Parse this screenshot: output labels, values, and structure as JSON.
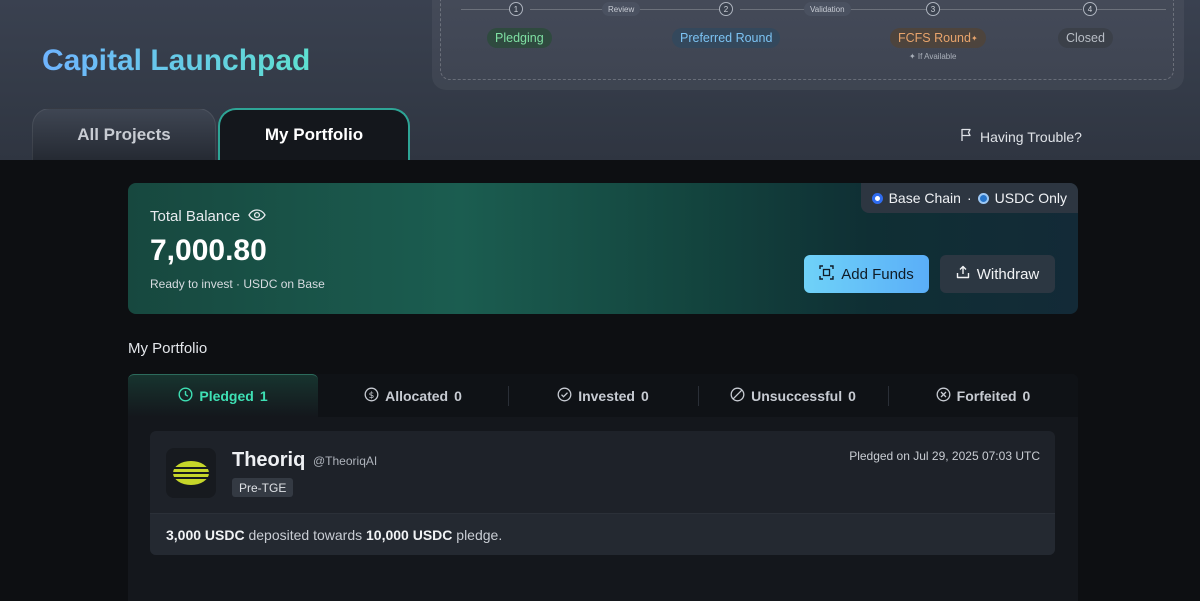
{
  "app": {
    "title": "Capital Launchpad"
  },
  "stepper": {
    "steps": [
      {
        "num": "1",
        "label": "Pledging",
        "color": "#7fe0a3",
        "bg": "#3b4c48"
      },
      {
        "num": "2",
        "label": "Preferred Round",
        "color": "#7cc3f3",
        "bg": "#3a4858"
      },
      {
        "num": "3",
        "label": "FCFS Round",
        "superscript": "✦",
        "sub": "✦ If Available",
        "color": "#e8a46c",
        "bg": "#4f4842"
      },
      {
        "num": "4",
        "label": "Closed",
        "color": "#b8bdc5",
        "bg": "#40454f"
      }
    ],
    "tags": [
      "Review",
      "Validation"
    ]
  },
  "tabs": {
    "all": "All Projects",
    "mine": "My Portfolio"
  },
  "help": {
    "label": "Having Trouble?"
  },
  "balance": {
    "label": "Total Balance",
    "amount": "7,000.80",
    "subtitle": "Ready to invest · USDC on Base",
    "chain": "Base Chain",
    "separator": "·",
    "token": "USDC Only",
    "add_funds": "Add Funds",
    "withdraw": "Withdraw"
  },
  "portfolio": {
    "title": "My Portfolio",
    "tabs": [
      {
        "label": "Pledged",
        "count": "1",
        "icon": "clock-icon",
        "active": true
      },
      {
        "label": "Allocated",
        "count": "0",
        "icon": "dollar-circle-icon",
        "active": false
      },
      {
        "label": "Invested",
        "count": "0",
        "icon": "check-circle-icon",
        "active": false
      },
      {
        "label": "Unsuccessful",
        "count": "0",
        "icon": "ban-icon",
        "active": false
      },
      {
        "label": "Forfeited",
        "count": "0",
        "icon": "x-circle-icon",
        "active": false
      }
    ],
    "project": {
      "name": "Theoriq",
      "handle": "@TheoriqAI",
      "tag": "Pre-TGE",
      "pledged_on": "Pledged on Jul 29, 2025 07:03 UTC",
      "deposited_amount": "3,000 USDC",
      "deposited_text": " deposited towards ",
      "pledge_amount": "10,000 USDC",
      "pledge_text": " pledge."
    }
  },
  "colors": {
    "accent_teal": "#3ee0b4",
    "add_funds_gradient_start": "#6fd2f8",
    "add_funds_gradient_end": "#5aaef8",
    "base_chain_dot": "#2f6cf0",
    "usdc_dot": "#2775ca"
  }
}
